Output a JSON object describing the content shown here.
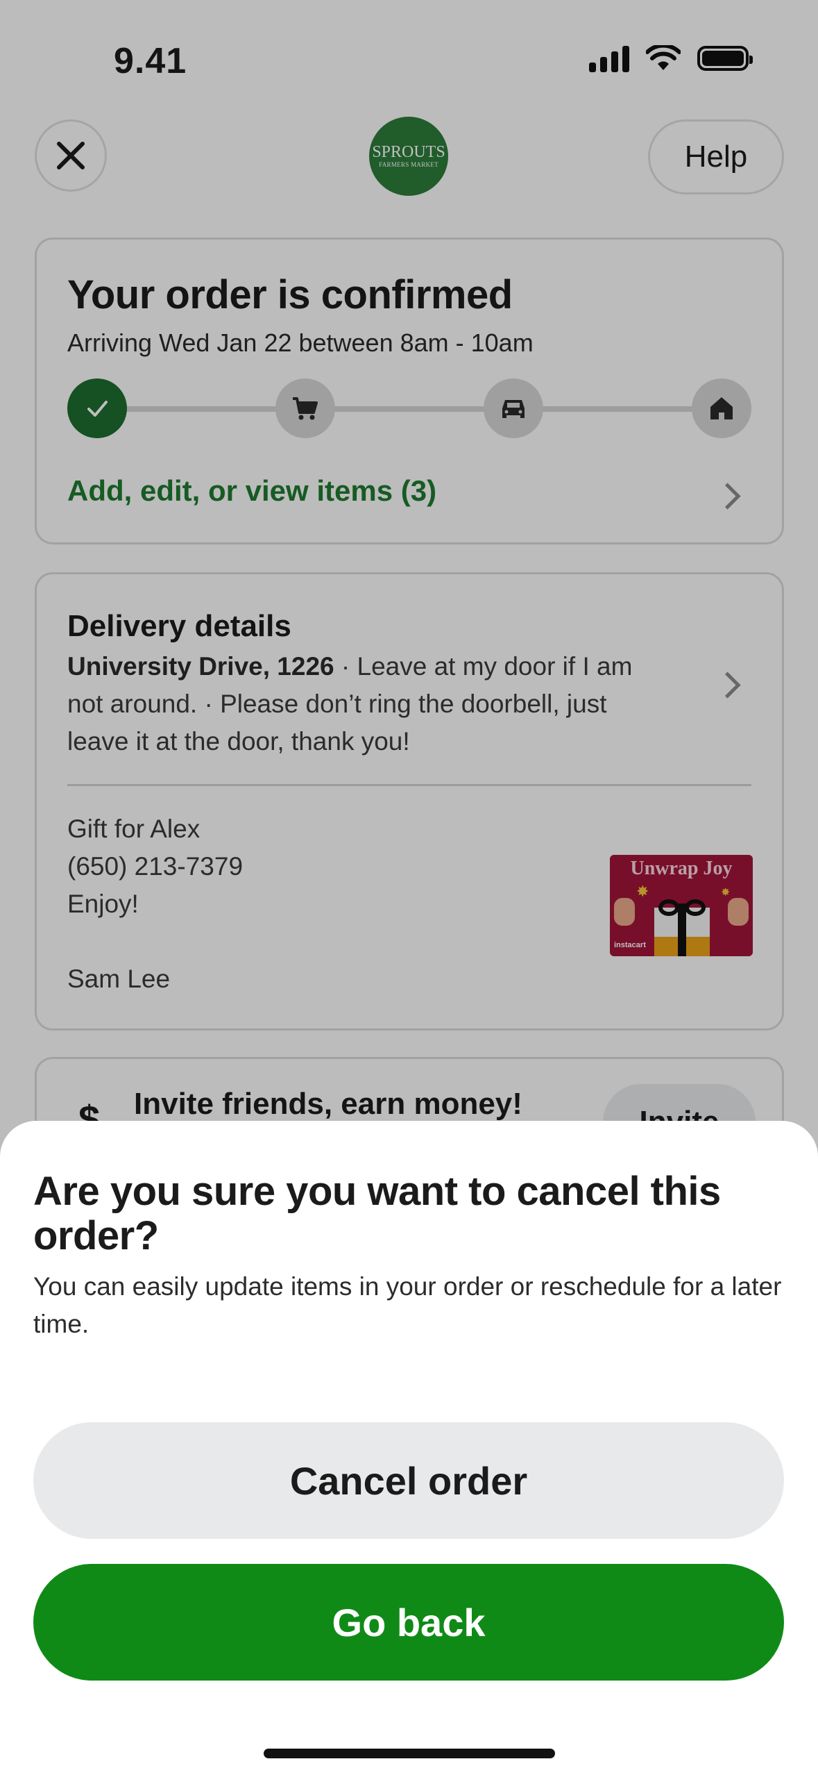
{
  "status_bar": {
    "time": "9.41"
  },
  "header": {
    "logo_line1": "SPROUTS",
    "logo_line2": "FARMERS MARKET",
    "help_label": "Help"
  },
  "order": {
    "title": "Your order is confirmed",
    "subtitle": "Arriving Wed Jan 22 between 8am - 10am",
    "items_link": "Add, edit, or view items (3)",
    "steps": [
      "check-icon",
      "cart-icon",
      "car-icon",
      "home-icon"
    ]
  },
  "delivery": {
    "title": "Delivery details",
    "address": "University Drive, 1226",
    "instructions": " · Leave at my door if I am not around. · Please don’t ring the doorbell, just leave it at the door, thank you!",
    "gift_for": "Gift for Alex",
    "phone": "(650) 213-7379",
    "message": "Enjoy!",
    "sender": "Sam Lee",
    "gift_card_title": "Unwrap Joy",
    "gift_card_brand": "instacart"
  },
  "invite": {
    "icon": "$",
    "text": "Invite friends, earn money!",
    "button": "Invite"
  },
  "sheet": {
    "title": "Are you sure you want to cancel this order?",
    "message": "You can easily update items in your order or reschedule for a later time.",
    "cancel_label": "Cancel order",
    "back_label": "Go back"
  },
  "colors": {
    "brand_green": "#108a17",
    "link_green": "#1e7a2f",
    "logo_green": "#2d7b3a",
    "gift_card_red": "#a01438"
  }
}
